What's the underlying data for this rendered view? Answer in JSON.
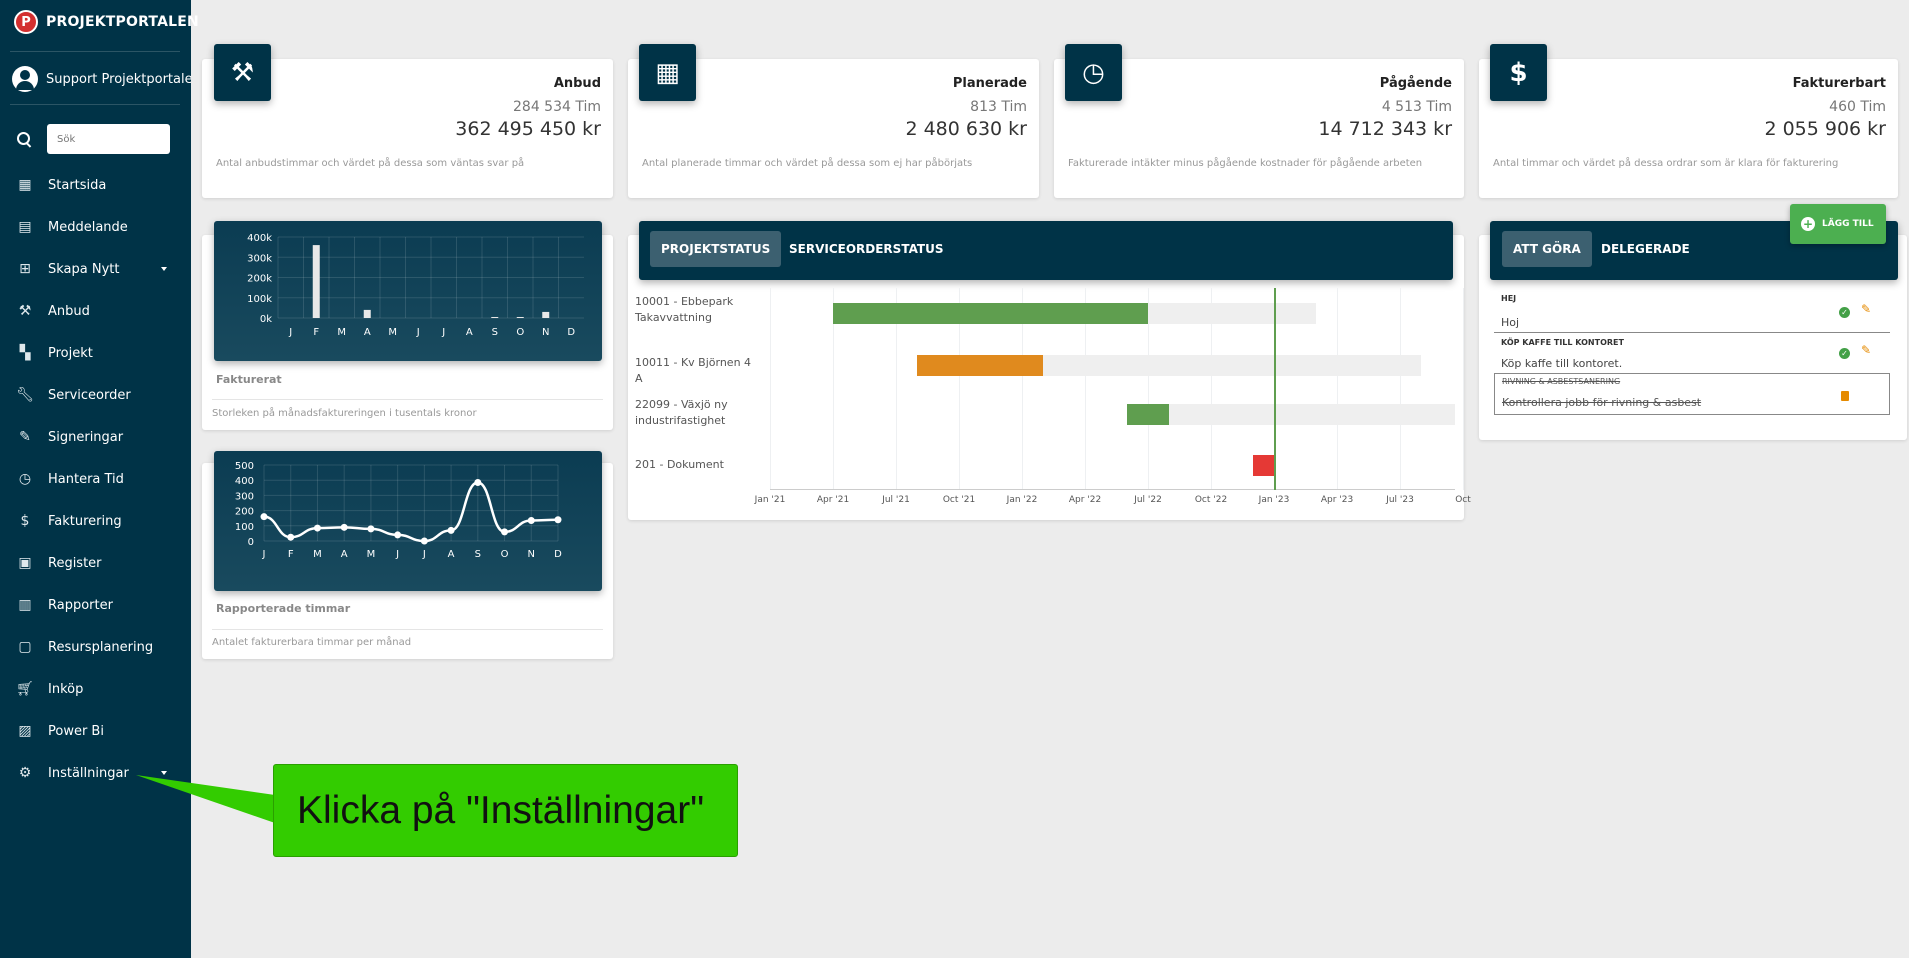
{
  "app": {
    "name": "PROJEKTPORTALEN",
    "logo_letter": "P"
  },
  "user": {
    "name": "Support Projektportalen"
  },
  "search": {
    "placeholder": "Sök"
  },
  "nav": [
    {
      "label": "Startsida",
      "icon": "dashboard-icon"
    },
    {
      "label": "Meddelande",
      "icon": "message-icon"
    },
    {
      "label": "Skapa Nytt",
      "icon": "add-box-icon"
    },
    {
      "label": "Anbud",
      "icon": "gavel-icon"
    },
    {
      "label": "Projekt",
      "icon": "projects-icon"
    },
    {
      "label": "Serviceorder",
      "icon": "wrench-icon"
    },
    {
      "label": "Signeringar",
      "icon": "pen-icon"
    },
    {
      "label": "Hantera Tid",
      "icon": "clock-icon"
    },
    {
      "label": "Fakturering",
      "icon": "dollar-icon"
    },
    {
      "label": "Register",
      "icon": "image-icon"
    },
    {
      "label": "Rapporter",
      "icon": "calendar-report-icon"
    },
    {
      "label": "Resursplanering",
      "icon": "calendar-icon"
    },
    {
      "label": "Inköp",
      "icon": "cart-icon"
    },
    {
      "label": "Power Bi",
      "icon": "chart-icon"
    },
    {
      "label": "Inställningar",
      "icon": "gear-icon"
    }
  ],
  "stats": [
    {
      "title": "Anbud",
      "hours": "284 534 Tim",
      "amount": "362 495 450 kr",
      "desc": "Antal anbudstimmar och värdet på dessa som väntas svar på",
      "icon": "gavel-icon"
    },
    {
      "title": "Planerade",
      "hours": "813 Tim",
      "amount": "2 480 630 kr",
      "desc": "Antal planerade timmar och värdet på dessa som ej har påbörjats",
      "icon": "calendar-icon"
    },
    {
      "title": "Pågående",
      "hours": "4 513 Tim",
      "amount": "14 712 343 kr",
      "desc": "Fakturerade intäkter minus pågående kostnader för pågående arbeten",
      "icon": "clock-icon"
    },
    {
      "title": "Fakturerbart",
      "hours": "460 Tim",
      "amount": "2 055 906 kr",
      "desc": "Antal timmar och värdet på dessa ordrar som är klara för fakturering",
      "icon": "dollar-icon"
    }
  ],
  "charts": {
    "invoiced": {
      "title": "Fakturerat",
      "desc": "Storleken på månadsfaktureringen i tusentals kronor"
    },
    "hours": {
      "title": "Rapporterade timmar",
      "desc": "Antalet fakturerbara timmar per månad"
    }
  },
  "chart_data": [
    {
      "type": "bar",
      "categories": [
        "J",
        "F",
        "M",
        "A",
        "M",
        "J",
        "J",
        "A",
        "S",
        "O",
        "N",
        "D"
      ],
      "values": [
        0,
        360,
        0,
        40,
        0,
        0,
        0,
        0,
        5,
        5,
        30,
        0
      ],
      "ticks": [
        "400k",
        "300k",
        "200k",
        "100k",
        "0k"
      ],
      "ylim": [
        0,
        400
      ],
      "title": "",
      "xlabel": "",
      "ylabel": ""
    },
    {
      "type": "line",
      "categories": [
        "J",
        "F",
        "M",
        "A",
        "M",
        "J",
        "J",
        "A",
        "S",
        "O",
        "N",
        "D"
      ],
      "values": [
        160,
        25,
        85,
        90,
        80,
        40,
        0,
        70,
        385,
        60,
        135,
        140
      ],
      "ticks": [
        "500",
        "400",
        "300",
        "200",
        "100",
        "0"
      ],
      "ylim": [
        0,
        500
      ],
      "title": "",
      "xlabel": "",
      "ylabel": ""
    }
  ],
  "project_tabs": [
    "PROJEKTSTATUS",
    "SERVICEORDERSTATUS"
  ],
  "gantt": {
    "ticks": [
      "Jan '21",
      "Apr '21",
      "Jul '21",
      "Oct '21",
      "Jan '22",
      "Apr '22",
      "Jul '22",
      "Oct '22",
      "Jan '23",
      "Apr '23",
      "Jul '23",
      "Oct"
    ],
    "rows": [
      {
        "label": "10001 - Ebbepark Takavvattning",
        "start": "2021-04",
        "progress_end": "2022-07",
        "end": "2023-03",
        "color": "#5f9e4f"
      },
      {
        "label": "10011 - Kv Björnen 4 A",
        "start": "2021-08",
        "progress_end": "2022-02",
        "end": "2023-08",
        "color": "#e08a1e"
      },
      {
        "label": "22099 - Växjö ny industrifastighet",
        "start": "2022-06",
        "progress_end": "2022-08",
        "end": "2023-10",
        "color": "#5f9e4f"
      },
      {
        "label": "201 - Dokument",
        "start": "2022-12",
        "progress_end": "2023-01",
        "end": "2023-01",
        "color": "#e53935"
      }
    ],
    "today": "2023-01"
  },
  "todo_tabs": [
    "ATT GÖRA",
    "DELEGERADE"
  ],
  "add_button": "LÄGG TILL",
  "todos": [
    {
      "title": "HEJ",
      "text": "Hoj",
      "done": false
    },
    {
      "title": "KÖP KAFFE TILL KONTORET",
      "text": "Köp kaffe till kontoret.",
      "done": false
    },
    {
      "title": "RIVNING & ASBESTSANERING",
      "text": "Kontrollera jobb för rivning & asbest",
      "done": true
    }
  ],
  "callout": "Klicka på \"Inställningar\"",
  "colors": {
    "sidebar": "#003347",
    "accent_green": "#33cc00",
    "progress_green": "#5f9e4f",
    "progress_orange": "#e08a1e",
    "alert_red": "#e53935"
  }
}
